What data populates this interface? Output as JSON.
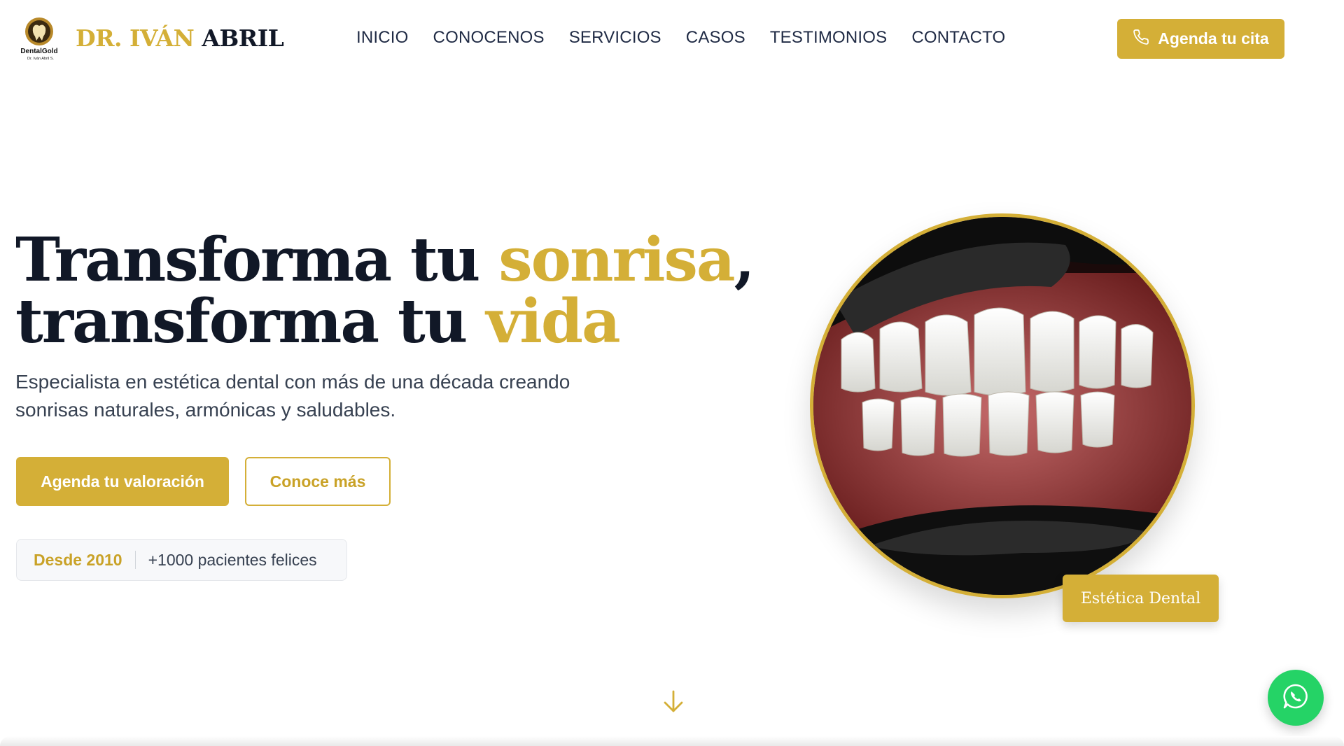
{
  "brand": {
    "logo_text": "DentalGold",
    "logo_subtext": "Dr. Iván Abril S.",
    "name_gold": "DR. IVÁN",
    "name_dark": "ABRIL"
  },
  "nav": {
    "items": [
      "INICIO",
      "CONOCENOS",
      "SERVICIOS",
      "CASOS",
      "TESTIMONIOS",
      "CONTACTO"
    ]
  },
  "header_cta": {
    "label": "Agenda tu cita",
    "icon": "phone-icon"
  },
  "hero": {
    "title_line1_a": "Transforma tu ",
    "title_line1_b": "sonrisa",
    "title_line1_c": ",",
    "title_line2_a": "transforma tu ",
    "title_line2_b": "vida",
    "subtitle": "Especialista en estética dental con más de una década creando sonrisas naturales, armónicas y saludables.",
    "primary_button": "Agenda tu valoración",
    "secondary_button": "Conoce más",
    "stat_since": "Desde 2010",
    "stat_patients": "+1000 pacientes felices"
  },
  "photo_badge": "Estética Dental",
  "colors": {
    "gold": "#d4af37",
    "dark": "#111827",
    "whatsapp": "#25d366"
  },
  "icons": {
    "scroll": "arrow-down-icon",
    "chat": "whatsapp-icon"
  }
}
